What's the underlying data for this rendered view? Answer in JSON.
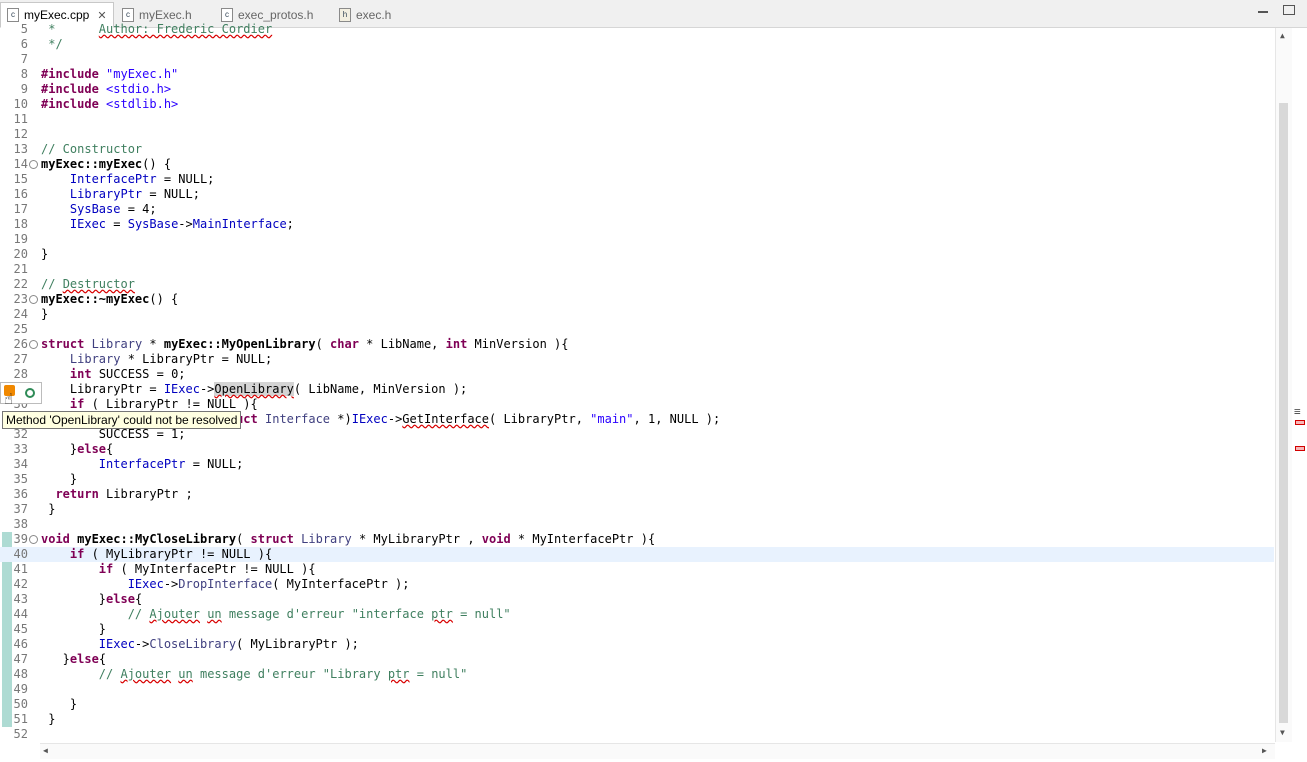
{
  "tabs": [
    {
      "label": "myExec.cpp",
      "icon": "c-source-file-icon",
      "active": true
    },
    {
      "label": "myExec.h",
      "icon": "c-source-file-icon",
      "active": false
    },
    {
      "label": "exec_protos.h",
      "icon": "c-source-file-icon",
      "active": false
    },
    {
      "label": "exec.h",
      "icon": "header-file-icon",
      "active": false
    }
  ],
  "close_glyph": "✕",
  "fold_glyph": "⊖",
  "tooltip": "Method 'OpenLibrary' could not be resolved",
  "scroll": {
    "up": "▲",
    "down": "▼",
    "left": "◀",
    "right": "▶",
    "split": "≡"
  },
  "colors": {
    "keyword": "#7f0055",
    "string": "#2a00ff",
    "comment": "#3f7f5f",
    "field": "#0000c0",
    "current_line": "#e8f2fe",
    "change_bar": "#aedbd3",
    "tooltip_bg": "#ffffe1"
  },
  "code_lines": [
    {
      "n": "5",
      "t": [
        [
          "c",
          " *      "
        ],
        [
          "c sq",
          "Author: Frederic Cordier"
        ]
      ]
    },
    {
      "n": "6",
      "t": [
        [
          "c",
          " */"
        ]
      ]
    },
    {
      "n": "7",
      "t": []
    },
    {
      "n": "8",
      "t": [
        [
          "k",
          "#include"
        ],
        [
          "",
          " "
        ],
        [
          "s",
          "\"myExec.h\""
        ]
      ]
    },
    {
      "n": "9",
      "t": [
        [
          "k",
          "#include"
        ],
        [
          "",
          " "
        ],
        [
          "s",
          "<stdio.h>"
        ]
      ]
    },
    {
      "n": "10",
      "t": [
        [
          "k",
          "#include"
        ],
        [
          "",
          " "
        ],
        [
          "s",
          "<stdlib.h>"
        ]
      ]
    },
    {
      "n": "11",
      "t": []
    },
    {
      "n": "12",
      "t": []
    },
    {
      "n": "13",
      "t": [
        [
          "c",
          "// Constructor"
        ]
      ]
    },
    {
      "n": "14",
      "fold": true,
      "t": [
        [
          "b",
          "myExec::myExec"
        ],
        [
          "",
          "() {"
        ]
      ]
    },
    {
      "n": "15",
      "t": [
        [
          "",
          "    "
        ],
        [
          "v",
          "InterfacePtr"
        ],
        [
          "",
          " = NULL;"
        ]
      ]
    },
    {
      "n": "16",
      "t": [
        [
          "",
          "    "
        ],
        [
          "v",
          "LibraryPtr"
        ],
        [
          "",
          " = NULL;"
        ]
      ]
    },
    {
      "n": "17",
      "t": [
        [
          "",
          "    "
        ],
        [
          "v",
          "SysBase"
        ],
        [
          "",
          " = 4;"
        ]
      ]
    },
    {
      "n": "18",
      "t": [
        [
          "",
          "    "
        ],
        [
          "v",
          "IExec"
        ],
        [
          "",
          " = "
        ],
        [
          "v",
          "SysBase"
        ],
        [
          "",
          "->"
        ],
        [
          "v",
          "MainInterface"
        ],
        [
          "",
          ";"
        ]
      ]
    },
    {
      "n": "19",
      "t": []
    },
    {
      "n": "20",
      "t": [
        [
          "",
          "}"
        ]
      ]
    },
    {
      "n": "21",
      "t": []
    },
    {
      "n": "22",
      "t": [
        [
          "c",
          "// "
        ],
        [
          "c sq",
          "Destructor"
        ]
      ]
    },
    {
      "n": "23",
      "fold": true,
      "t": [
        [
          "b",
          "myExec::~myExec"
        ],
        [
          "",
          "() {"
        ]
      ]
    },
    {
      "n": "24",
      "t": [
        [
          "",
          "}"
        ]
      ]
    },
    {
      "n": "25",
      "t": []
    },
    {
      "n": "26",
      "fold": true,
      "t": [
        [
          "k",
          "struct"
        ],
        [
          "",
          " "
        ],
        [
          "f",
          "Library"
        ],
        [
          "",
          " * "
        ],
        [
          "b",
          "myExec::MyOpenLibrary"
        ],
        [
          "",
          "( "
        ],
        [
          "k",
          "char"
        ],
        [
          "",
          " * LibName, "
        ],
        [
          "k",
          "int"
        ],
        [
          "",
          " MinVersion ){"
        ]
      ]
    },
    {
      "n": "27",
      "t": [
        [
          "",
          "    "
        ],
        [
          "f",
          "Library"
        ],
        [
          "",
          " * LibraryPtr = NULL;"
        ]
      ]
    },
    {
      "n": "28",
      "t": [
        [
          "",
          "    "
        ],
        [
          "k",
          "int"
        ],
        [
          "",
          " SUCCESS = 0;"
        ]
      ]
    },
    {
      "n": "29",
      "t": [
        [
          "",
          "    LibraryPtr = "
        ],
        [
          "v",
          "IExec"
        ],
        [
          "",
          "->"
        ],
        [
          "sq hl",
          "OpenLibrary"
        ],
        [
          "",
          "( LibName, MinVersion );"
        ]
      ]
    },
    {
      "n": "30",
      "t": [
        [
          "",
          "    "
        ],
        [
          "k",
          "if"
        ],
        [
          "",
          " ( LibraryPtr != NULL ){"
        ]
      ]
    },
    {
      "n": "31",
      "t": [
        [
          "",
          "        "
        ],
        [
          "v",
          "InterfacePtr"
        ],
        [
          "",
          " = ("
        ],
        [
          "k",
          "struct"
        ],
        [
          "",
          " "
        ],
        [
          "f",
          "Interface"
        ],
        [
          "",
          " *)"
        ],
        [
          "v",
          "IExec"
        ],
        [
          "",
          "->"
        ],
        [
          "sq",
          "GetInterface"
        ],
        [
          "",
          "( LibraryPtr, "
        ],
        [
          "s",
          "\"main\""
        ],
        [
          "",
          ", 1, NULL );"
        ]
      ]
    },
    {
      "n": "32",
      "t": [
        [
          "",
          "        SUCCESS = 1;"
        ]
      ]
    },
    {
      "n": "33",
      "t": [
        [
          "",
          "    }"
        ],
        [
          "k",
          "else"
        ],
        [
          "",
          "{"
        ]
      ]
    },
    {
      "n": "34",
      "t": [
        [
          "",
          "        "
        ],
        [
          "v",
          "InterfacePtr"
        ],
        [
          "",
          " = NULL;"
        ]
      ]
    },
    {
      "n": "35",
      "t": [
        [
          "",
          "    }"
        ]
      ]
    },
    {
      "n": "36",
      "t": [
        [
          "",
          "  "
        ],
        [
          "k",
          "return"
        ],
        [
          "",
          " LibraryPtr ;"
        ]
      ]
    },
    {
      "n": "37",
      "t": [
        [
          "",
          " }"
        ]
      ]
    },
    {
      "n": "38",
      "t": []
    },
    {
      "n": "39",
      "fold": true,
      "t": [
        [
          "k",
          "void"
        ],
        [
          "",
          " "
        ],
        [
          "b",
          "myExec::MyCloseLibrary"
        ],
        [
          "",
          "( "
        ],
        [
          "k",
          "struct"
        ],
        [
          "",
          " "
        ],
        [
          "f",
          "Library"
        ],
        [
          "",
          " * MyLibraryPtr , "
        ],
        [
          "k",
          "void"
        ],
        [
          "",
          " * MyInterfacePtr ){"
        ]
      ]
    },
    {
      "n": "40",
      "current": true,
      "t": [
        [
          "",
          "    "
        ],
        [
          "k",
          "if"
        ],
        [
          "",
          " ( MyLibraryPtr != NULL ){"
        ]
      ]
    },
    {
      "n": "41",
      "t": [
        [
          "",
          "        "
        ],
        [
          "k",
          "if"
        ],
        [
          "",
          " ( MyInterfacePtr != NULL ){"
        ]
      ]
    },
    {
      "n": "42",
      "t": [
        [
          "",
          "            "
        ],
        [
          "v",
          "IExec"
        ],
        [
          "",
          "->"
        ],
        [
          "f",
          "DropInterface"
        ],
        [
          "",
          "( MyInterfacePtr );"
        ]
      ]
    },
    {
      "n": "43",
      "t": [
        [
          "",
          "        }"
        ],
        [
          "k",
          "else"
        ],
        [
          "",
          "{"
        ]
      ]
    },
    {
      "n": "44",
      "t": [
        [
          "",
          "            "
        ],
        [
          "c",
          "// "
        ],
        [
          "c sq",
          "Ajouter"
        ],
        [
          "c",
          " "
        ],
        [
          "c sq",
          "un"
        ],
        [
          "c",
          " message d'erreur \"interface "
        ],
        [
          "c sq",
          "ptr"
        ],
        [
          "c",
          " = null\""
        ]
      ]
    },
    {
      "n": "45",
      "t": [
        [
          "",
          "        }"
        ]
      ]
    },
    {
      "n": "46",
      "t": [
        [
          "",
          "        "
        ],
        [
          "v",
          "IExec"
        ],
        [
          "",
          "->"
        ],
        [
          "f",
          "CloseLibrary"
        ],
        [
          "",
          "( MyLibraryPtr );"
        ]
      ]
    },
    {
      "n": "47",
      "t": [
        [
          "",
          "   }"
        ],
        [
          "k",
          "else"
        ],
        [
          "",
          "{"
        ]
      ]
    },
    {
      "n": "48",
      "t": [
        [
          "",
          "        "
        ],
        [
          "c",
          "// "
        ],
        [
          "c sq",
          "Ajouter"
        ],
        [
          "c",
          " "
        ],
        [
          "c sq",
          "un"
        ],
        [
          "c",
          " message d'erreur \"Library "
        ],
        [
          "c sq",
          "ptr"
        ],
        [
          "c",
          " = null\""
        ]
      ]
    },
    {
      "n": "49",
      "t": []
    },
    {
      "n": "50",
      "t": [
        [
          "",
          "    }"
        ]
      ]
    },
    {
      "n": "51",
      "t": [
        [
          "",
          " }"
        ]
      ]
    },
    {
      "n": "52",
      "t": []
    }
  ]
}
